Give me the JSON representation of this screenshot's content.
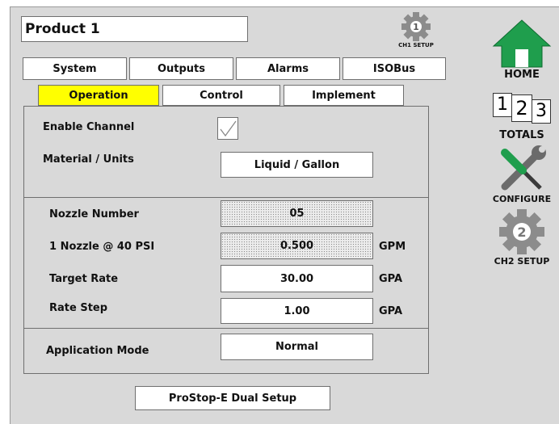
{
  "product_title": "Product 1",
  "ch1_setup_label": "CH1 SETUP",
  "ch1_badge": "1",
  "main_tabs": [
    "System",
    "Outputs",
    "Alarms",
    "ISOBus"
  ],
  "sub_tabs": [
    "Operation",
    "Control",
    "Implement"
  ],
  "fields": {
    "enable_channel": {
      "label": "Enable Channel",
      "checked": true
    },
    "material_units": {
      "label": "Material / Units",
      "value": "Liquid / Gallon"
    },
    "nozzle_number": {
      "label": "Nozzle Number",
      "value": "05"
    },
    "nozzle_flow": {
      "label": "1 Nozzle @ 40 PSI",
      "value": "0.500",
      "unit": "GPM"
    },
    "target_rate": {
      "label": "Target Rate",
      "value": "30.00",
      "unit": "GPA"
    },
    "rate_step": {
      "label": "Rate Step",
      "value": "1.00",
      "unit": "GPA"
    },
    "application_mode": {
      "label": "Application Mode",
      "value": "Normal"
    }
  },
  "bottom_button": "ProStop-E Dual Setup",
  "sidebar": {
    "home": "HOME",
    "totals": "TOTALS",
    "totals_digits": [
      "1",
      "2",
      "3"
    ],
    "configure": "CONFIGURE",
    "ch2_setup": "CH2 SETUP",
    "ch2_badge": "2"
  },
  "colors": {
    "active_tab": "#ffff00",
    "home_green": "#1f9e4d",
    "gear_gray": "#8c8c8c"
  }
}
